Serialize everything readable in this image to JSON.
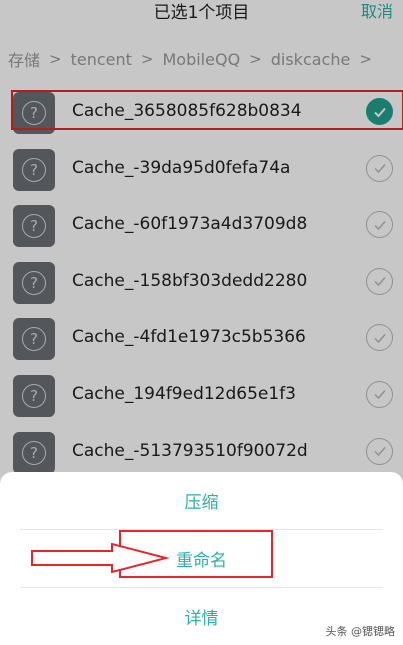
{
  "header": {
    "title": "已选1个项目",
    "cancel_label": "取消"
  },
  "breadcrumb": [
    "存储",
    "tencent",
    "MobileQQ",
    "diskcache"
  ],
  "breadcrumb_separator": ">",
  "files": [
    {
      "name": "Cache_3658085f628b0834",
      "checked": true
    },
    {
      "name": "Cache_-39da95d0fefa74a",
      "checked": false
    },
    {
      "name": "Cache_-60f1973a4d3709d8",
      "checked": false
    },
    {
      "name": "Cache_-158bf303dedd2280",
      "checked": false
    },
    {
      "name": "Cache_-4fd1e1973c5b5366",
      "checked": false
    },
    {
      "name": "Cache_194f9ed12d65e1f3",
      "checked": false
    },
    {
      "name": "Cache_-513793510f90072d",
      "checked": false
    }
  ],
  "file_icon": "unknown-file-icon",
  "sheet": {
    "compress_label": "压缩",
    "rename_label": "重命名",
    "details_label": "详情"
  },
  "watermark": "头条 @锶锶略",
  "colors": {
    "accent": "#2bb1a6",
    "checked": "#22a08f",
    "annotation": "#e5262c"
  }
}
